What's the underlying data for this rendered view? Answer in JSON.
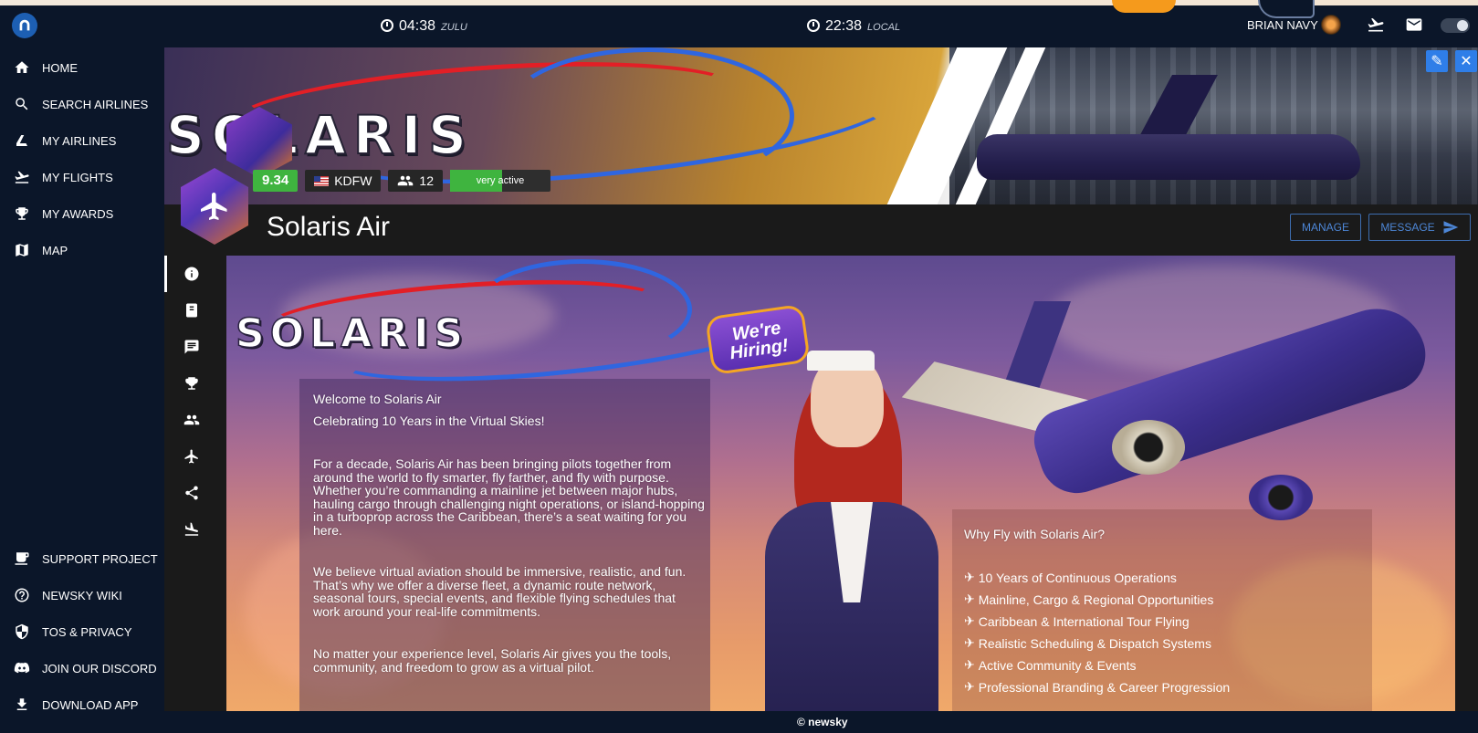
{
  "topbar": {
    "zulu_time": "04:38",
    "zulu_tag": "ZULU",
    "local_time": "22:38",
    "local_tag": "LOCAL",
    "user_name": "BRIAN NAVY"
  },
  "sidebar": {
    "items": [
      {
        "label": "HOME",
        "icon": "home-icon"
      },
      {
        "label": "SEARCH AIRLINES",
        "icon": "search-icon"
      },
      {
        "label": "MY AIRLINES",
        "icon": "airline-tail-icon"
      },
      {
        "label": "MY FLIGHTS",
        "icon": "takeoff-icon"
      },
      {
        "label": "MY AWARDS",
        "icon": "trophy-icon"
      },
      {
        "label": "MAP",
        "icon": "map-icon"
      }
    ],
    "bottom_items": [
      {
        "label": "SUPPORT PROJECT",
        "icon": "coffee-icon"
      },
      {
        "label": "NEWSKY WIKI",
        "icon": "help-icon"
      },
      {
        "label": "TOS & PRIVACY",
        "icon": "shield-icon"
      },
      {
        "label": "JOIN OUR DISCORD",
        "icon": "discord-icon"
      },
      {
        "label": "DOWNLOAD APP",
        "icon": "download-icon"
      }
    ]
  },
  "airline": {
    "name": "Solaris Air",
    "banner_brand": "SOLARIS",
    "rating": "9.34",
    "hub": "KDFW",
    "members": "12",
    "activity": "very active",
    "activity_level": 0.52,
    "manage_label": "MANAGE",
    "message_label": "MESSAGE"
  },
  "tabs": [
    {
      "icon": "info-icon",
      "active": true
    },
    {
      "icon": "book-icon",
      "active": false
    },
    {
      "icon": "chat-icon",
      "active": false
    },
    {
      "icon": "trophy-icon",
      "active": false
    },
    {
      "icon": "members-icon",
      "active": false
    },
    {
      "icon": "plane-icon",
      "active": false
    },
    {
      "icon": "share-icon",
      "active": false
    },
    {
      "icon": "landing-icon",
      "active": false
    }
  ],
  "content": {
    "brand": "SOLARIS",
    "hiring_badge": "We're Hiring!",
    "welcome": "Welcome to Solaris Air",
    "celebrating": "Celebrating 10 Years in the Virtual Skies!",
    "para1": "For a decade, Solaris Air has been bringing pilots together from around the world to fly smarter, fly farther, and fly with purpose. Whether you’re commanding a mainline jet between major hubs, hauling cargo through challenging night operations, or island-hopping in a turboprop across the Caribbean, there’s a seat waiting for you here.",
    "para2": "We believe virtual aviation should be immersive, realistic, and fun. That’s why we offer a diverse fleet, a dynamic route network, seasonal tours, special events, and flexible flying schedules that work around your real-life commitments.",
    "para3": "No matter your experience level, Solaris Air gives you the tools, community, and freedom to grow as a virtual pilot.",
    "why_title": "Why Fly with Solaris Air?",
    "bullets": [
      "10 Years of Continuous Operations",
      "Mainline, Cargo & Regional Opportunities",
      "Caribbean & International Tour Flying",
      "Realistic Scheduling & Dispatch Systems",
      "Active Community & Events",
      "Professional Branding & Career Progression"
    ],
    "bullet_glyph": "✈"
  },
  "footer": {
    "text": "© newsky"
  },
  "colors": {
    "bg": "#0b1629",
    "accent": "#2f7ee8",
    "rating_green": "#3fb43f",
    "panel": "#1a1a1a"
  }
}
